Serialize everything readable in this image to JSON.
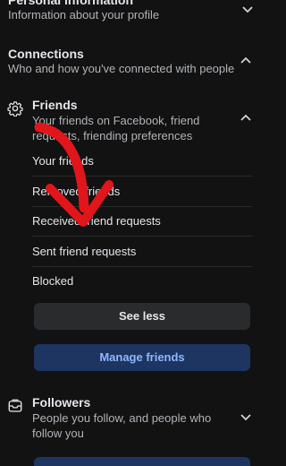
{
  "personal_info": {
    "title": "Personal information",
    "subtitle": "Information about your profile"
  },
  "connections": {
    "title": "Connections",
    "subtitle": "Who and how you've connected with people"
  },
  "friends": {
    "title": "Friends",
    "subtitle": "Your friends on Facebook, friend requests, friending preferences",
    "items": [
      {
        "label": "Your friends"
      },
      {
        "label": "Removed friends"
      },
      {
        "label": "Received friend requests"
      },
      {
        "label": "Sent friend requests"
      },
      {
        "label": "Blocked"
      }
    ],
    "see_less_label": "See less",
    "manage_label": "Manage friends"
  },
  "followers": {
    "title": "Followers",
    "subtitle": "People you follow, and people who follow you"
  },
  "colors": {
    "background": "#121212",
    "annotation_arrow": "#e0161b",
    "primary_button_bg": "#1d3560",
    "primary_button_text": "#8fb6ff"
  },
  "icons": {
    "friends": "gear-icon",
    "followers": "inbox-icon",
    "collapse": "chevron-up-icon",
    "expand": "chevron-down-icon"
  }
}
